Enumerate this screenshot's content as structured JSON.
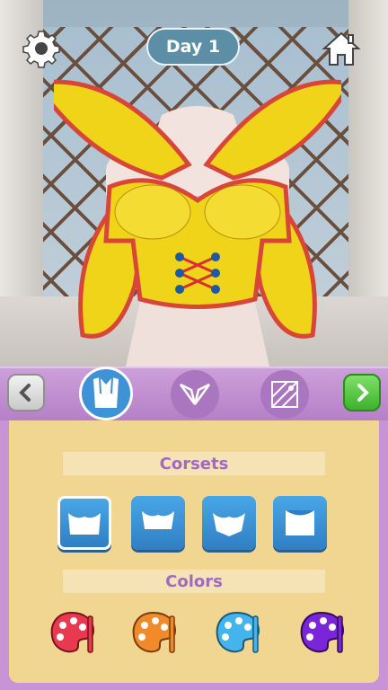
{
  "hud": {
    "day_label": "Day 1",
    "settings_icon": "gear-icon",
    "home_icon": "home-icon"
  },
  "toolbar": {
    "prev_icon": "chevron-left-icon",
    "next_icon": "chevron-right-icon",
    "categories": [
      {
        "icon": "corset-icon",
        "selected": true
      },
      {
        "icon": "wings-icon",
        "selected": false
      },
      {
        "icon": "pattern-icon",
        "selected": false
      }
    ]
  },
  "panel": {
    "corsets_title": "Corsets",
    "colors_title": "Colors",
    "corset_options": [
      {
        "icon": "corset-style-1-icon",
        "selected": true
      },
      {
        "icon": "corset-style-2-icon",
        "selected": false
      },
      {
        "icon": "corset-style-3-icon",
        "selected": false
      },
      {
        "icon": "corset-style-4-icon",
        "selected": false
      }
    ],
    "color_palettes": [
      {
        "icon": "palette-icon",
        "color": "#e8394f"
      },
      {
        "icon": "palette-icon",
        "color": "#f08a2a"
      },
      {
        "icon": "palette-icon",
        "color": "#45b4ec"
      },
      {
        "icon": "palette-icon",
        "color": "#7b25d8"
      }
    ]
  },
  "outfit": {
    "fabric_color": "#f0d41a",
    "trim_color": "#d8463a",
    "lace_color": "#d83030"
  }
}
